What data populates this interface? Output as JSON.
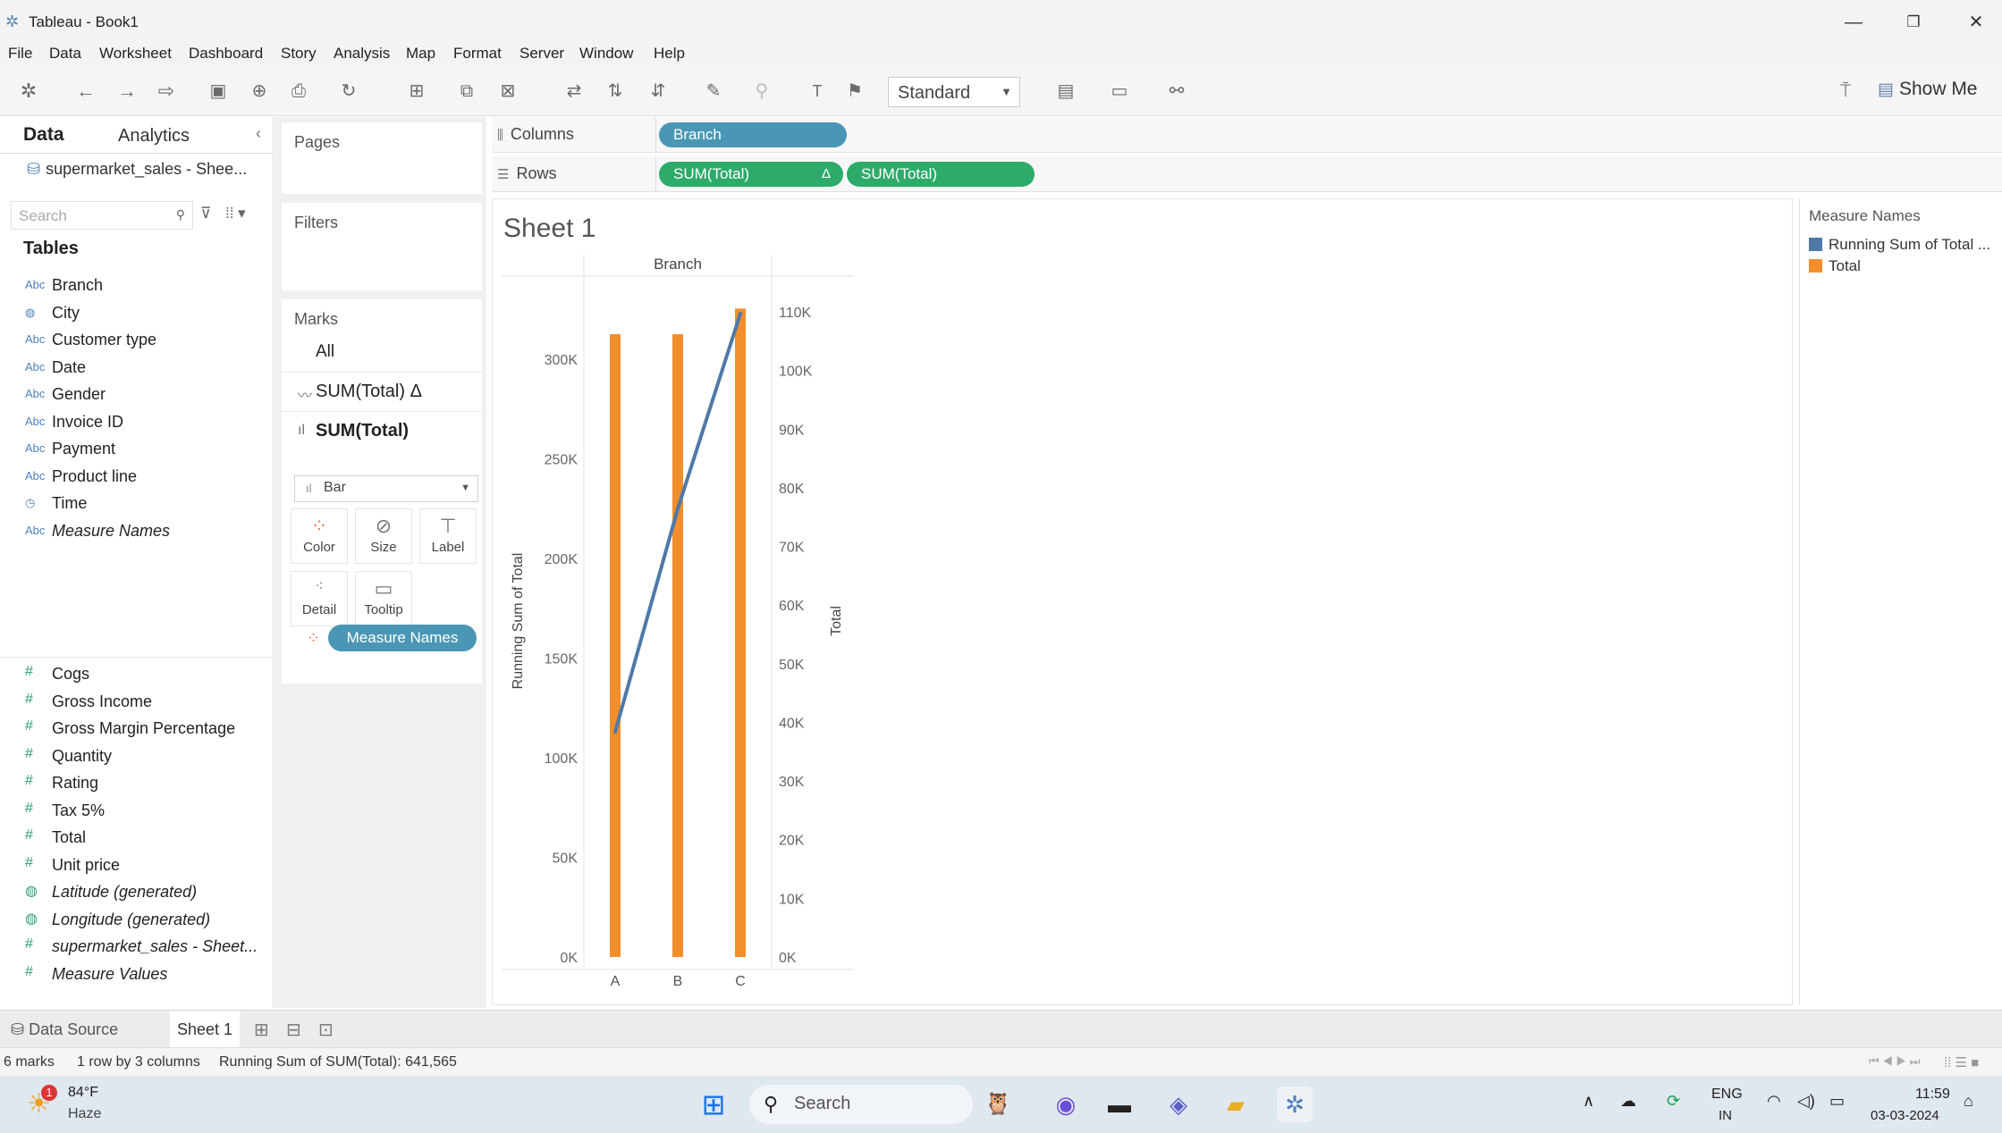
{
  "window": {
    "title": "Tableau - Book1",
    "minimize": "—",
    "restore": "❐",
    "close": "✕"
  },
  "menu": [
    "File",
    "Data",
    "Worksheet",
    "Dashboard",
    "Story",
    "Analysis",
    "Map",
    "Format",
    "Server",
    "Window",
    "Help"
  ],
  "toolbar": {
    "fit_select": "Standard",
    "show_me": "Show Me"
  },
  "data_pane": {
    "tab_data": "Data",
    "tab_analytics": "Analytics",
    "datasource": "supermarket_sales - Shee...",
    "search_placeholder": "Search",
    "tables_heading": "Tables",
    "dimensions": [
      {
        "name": "Branch",
        "icon": "Abc"
      },
      {
        "name": "City",
        "icon": "globe"
      },
      {
        "name": "Customer type",
        "icon": "Abc"
      },
      {
        "name": "Date",
        "icon": "Abc"
      },
      {
        "name": "Gender",
        "icon": "Abc"
      },
      {
        "name": "Invoice ID",
        "icon": "Abc"
      },
      {
        "name": "Payment",
        "icon": "Abc"
      },
      {
        "name": "Product line",
        "icon": "Abc"
      },
      {
        "name": "Time",
        "icon": "clock"
      },
      {
        "name": "Measure Names",
        "icon": "Abc"
      }
    ],
    "measures": [
      {
        "name": "Cogs"
      },
      {
        "name": "Gross Income"
      },
      {
        "name": "Gross Margin Percentage"
      },
      {
        "name": "Quantity"
      },
      {
        "name": "Rating"
      },
      {
        "name": "Tax 5%"
      },
      {
        "name": "Total"
      },
      {
        "name": "Unit price"
      },
      {
        "name": "Latitude (generated)"
      },
      {
        "name": "Longitude (generated)"
      },
      {
        "name": "supermarket_sales - Sheet..."
      },
      {
        "name": "Measure Values"
      }
    ]
  },
  "cards": {
    "pages": "Pages",
    "filters": "Filters",
    "marks": "Marks",
    "marks_all": "All",
    "marks_line": "SUM(Total) Δ",
    "marks_bar": "SUM(Total)",
    "mark_type": "Bar",
    "buttons": {
      "color": "Color",
      "size": "Size",
      "label": "Label",
      "detail": "Detail",
      "tooltip": "Tooltip"
    },
    "measure_names_pill": "Measure Names"
  },
  "shelves": {
    "columns_label": "Columns",
    "rows_label": "Rows",
    "columns_pill": "Branch",
    "rows_pill_1": "SUM(Total)",
    "rows_pill_1_delta": "Δ",
    "rows_pill_2": "SUM(Total)"
  },
  "sheet_title": "Sheet 1",
  "legend": {
    "title": "Measure Names",
    "items": [
      {
        "label": "Running Sum of Total ...",
        "color": "#4e79a7"
      },
      {
        "label": "Total",
        "color": "#f28e2b"
      }
    ]
  },
  "chart_data": {
    "type": "bar",
    "column_header": "Branch",
    "categories": [
      "A",
      "B",
      "C"
    ],
    "series": [
      {
        "name": "Total",
        "mark": "bar",
        "axis": "right",
        "color": "#f28e2b",
        "values": [
          106200,
          106198,
          110569
        ]
      },
      {
        "name": "Running Sum of Total",
        "mark": "line",
        "axis": "left",
        "color": "#4e79a7",
        "values": [
          113000,
          225000,
          322966
        ]
      }
    ],
    "left_axis": {
      "label": "Running Sum of Total",
      "ticks": [
        "0K",
        "50K",
        "100K",
        "150K",
        "200K",
        "250K",
        "300K"
      ],
      "range": [
        0,
        340000
      ]
    },
    "right_axis": {
      "label": "Total",
      "ticks": [
        "0K",
        "10K",
        "20K",
        "30K",
        "40K",
        "50K",
        "60K",
        "70K",
        "80K",
        "90K",
        "100K",
        "110K"
      ],
      "range": [
        0,
        115500
      ]
    }
  },
  "sheet_tabs": {
    "data_source": "Data Source",
    "sheet1": "Sheet 1"
  },
  "status": {
    "marks": "6 marks",
    "dims": "1 row by 3 columns",
    "sum": "Running Sum of SUM(Total): 641,565"
  },
  "taskbar": {
    "weather_temp": "84°F",
    "weather_desc": "Haze",
    "weather_badge": "1",
    "search": "Search",
    "lang_top": "ENG",
    "lang_bottom": "IN",
    "time": "11:59",
    "date": "03-03-2024"
  }
}
